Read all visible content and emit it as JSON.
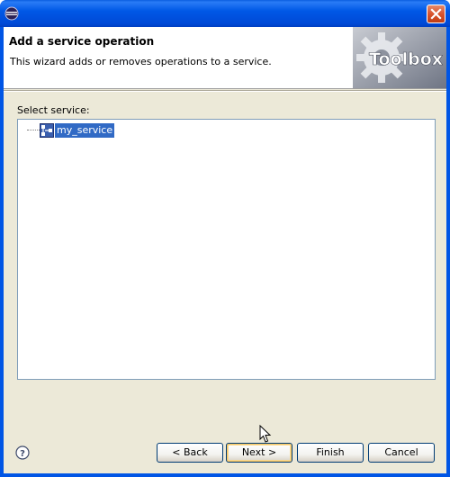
{
  "window": {
    "app_icon": "eclipse-icon",
    "close_icon": "close-icon"
  },
  "banner": {
    "title": "Add a service operation",
    "description": "This wizard adds or removes operations to a service.",
    "image_text": "Toolbox",
    "image_icon": "gear-icon"
  },
  "content": {
    "select_label": "Select service:",
    "tree": {
      "items": [
        {
          "label": "my_service",
          "icon": "service-icon",
          "selected": true
        }
      ]
    }
  },
  "footer": {
    "help_icon": "help-icon",
    "back_label": "< Back",
    "next_label": "Next >",
    "finish_label": "Finish",
    "cancel_label": "Cancel"
  },
  "colors": {
    "titlebar": "#0055e5",
    "selection": "#316ac5",
    "dialog_bg": "#ece9d8"
  }
}
